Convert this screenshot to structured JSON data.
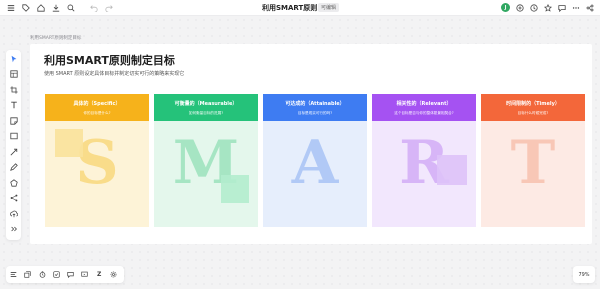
{
  "header": {
    "title": "利用SMART原则...",
    "badge": "可编辑",
    "avatar_initial": "J",
    "avatar_color": "#31a862"
  },
  "breadcrumb": "利用SMART原则制定目标",
  "page": {
    "title": "利用SMART原则制定目标",
    "subtitle": "使用 SMART 原则设定具体目标并制定切实可行的策略来实现它"
  },
  "columns": [
    {
      "name": "具体的（Specific）",
      "desc": "你的目标是什么?",
      "letter": "S",
      "head_color": "#f6b21b",
      "body_color": "#fdf3d7",
      "letter_color": "#f9dc8a",
      "sticky_color": "#fae29b"
    },
    {
      "name": "可衡量的（Measurable）",
      "desc": "如何衡量目标的进展?",
      "letter": "M",
      "head_color": "#25c27a",
      "body_color": "#e4f7ec",
      "letter_color": "#a6e5c3",
      "sticky_color": "#b3ecce"
    },
    {
      "name": "可达成的（Attainable）",
      "desc": "目标是现实可行的吗?",
      "letter": "A",
      "head_color": "#3e7cf2",
      "body_color": "#e6eefc",
      "letter_color": "#b1c9f6",
      "sticky_color": ""
    },
    {
      "name": "相关性的（Relevant）",
      "desc": "这个目标是否与你的整体愿景相契合?",
      "letter": "R",
      "head_color": "#a552f2",
      "body_color": "#f2e7fd",
      "letter_color": "#d7b5f7",
      "sticky_color": "#dec2f8"
    },
    {
      "name": "时间限制的（Timely）",
      "desc": "目标什么时候完成?",
      "letter": "T",
      "head_color": "#f3673a",
      "body_color": "#fdeae4",
      "letter_color": "#f8c7b6",
      "sticky_color": ""
    }
  ],
  "bottom": {
    "z_label": "Z"
  },
  "zoom": "79%"
}
